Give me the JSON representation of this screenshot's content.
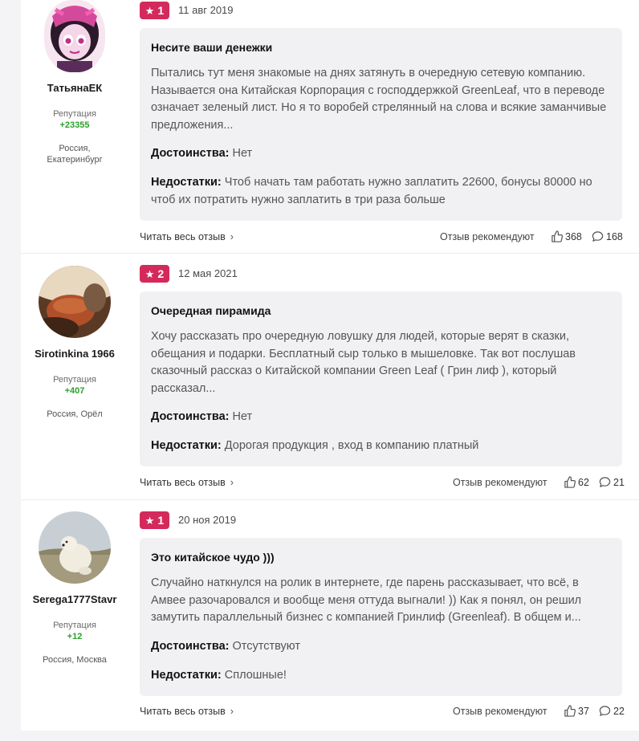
{
  "labels": {
    "reputation": "Репутация",
    "pros": "Достоинства:",
    "cons": "Недостатки:",
    "read_more": "Читать весь отзыв",
    "recommend": "Отзыв рекомендуют"
  },
  "reviews": [
    {
      "author": {
        "name": "ТатьянаЕК",
        "reputation": "+23355",
        "location_line1": "Россия,",
        "location_line2": "Екатеринбург",
        "avatar_icon": "anime-girl-avatar"
      },
      "rating": "1",
      "date": "11 авг 2019",
      "title": "Несите ваши денежки",
      "body": "Пытались тут меня знакомые на днях затянуть в очередную сетевую компанию. Называется она Китайская Корпорация с господдержкой GreenLeaf, что в переводе означает зеленый лист. Но я то воробей стрелянный на слова и всякие заманчивые предложения...",
      "pros": "Нет",
      "cons": "Чтоб начать там работать нужно заплатить 22600, бонусы 80000 но чтоб их потратить нужно заплатить в три раза больше",
      "likes": "368",
      "comments": "168"
    },
    {
      "author": {
        "name": "Sirotinkina 1966",
        "reputation": "+407",
        "location_line1": "Россия, Орёл",
        "location_line2": "",
        "avatar_icon": "photo-avatar"
      },
      "rating": "2",
      "date": "12 мая 2021",
      "title": "Очередная пирамида",
      "body": "Хочу рассказать про очередную ловушку для людей, которые верят в сказки, обещания и подарки. Бесплатный сыр только в мышеловке. Так вот послушав сказочный рассказ о Китайской компании Green Leaf ( Грин лиф ), который рассказал...",
      "pros": "Нет",
      "cons": "Дорогая продукция , вход в компанию платный",
      "likes": "62",
      "comments": "21"
    },
    {
      "author": {
        "name": "Serega1777Stavr",
        "reputation": "+12",
        "location_line1": "Россия, Москва",
        "location_line2": "",
        "avatar_icon": "polar-bear-avatar"
      },
      "rating": "1",
      "date": "20 ноя 2019",
      "title": "Это китайское чудо )))",
      "body": "Случайно наткнулся на ролик в интернете, где парень рассказывает, что всё, в Амвее разочаровался и вообще меня оттуда выгнали! )) Как я понял, он решил замутить параллельный бизнес с компанией Гринлиф (Greenleaf). В общем и...",
      "pros": "Отсутствуют",
      "cons": "Сплошные!",
      "likes": "37",
      "comments": "22"
    }
  ],
  "colors": {
    "rating_badge": "#d42a5b",
    "reputation": "#2ba12b",
    "card_bg": "#f1f1f3"
  }
}
